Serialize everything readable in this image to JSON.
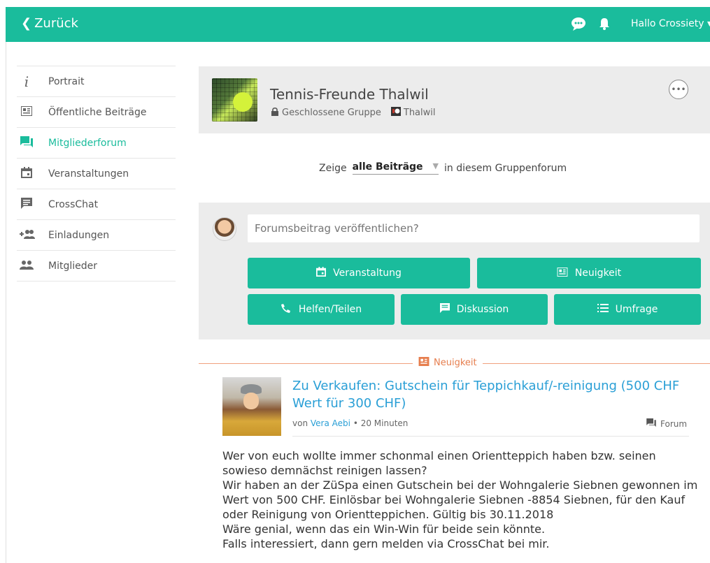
{
  "topbar": {
    "back_label": "Zurück",
    "greeting": "Hallo Crossiety",
    "icons": [
      "chat-bubble-icon",
      "bell-icon"
    ],
    "accent": "#1abc9c"
  },
  "sidebar": {
    "items": [
      {
        "label": "Portrait",
        "icon": "info-icon",
        "active": false
      },
      {
        "label": "Öffentliche Beiträge",
        "icon": "newspaper-icon",
        "active": false
      },
      {
        "label": "Mitgliederforum",
        "icon": "forum-icon",
        "active": true
      },
      {
        "label": "Veranstaltungen",
        "icon": "calendar-icon",
        "active": false
      },
      {
        "label": "CrossChat",
        "icon": "chat-icon",
        "active": false
      },
      {
        "label": "Einladungen",
        "icon": "add-people-icon",
        "active": false
      },
      {
        "label": "Mitglieder",
        "icon": "people-icon",
        "active": false
      }
    ]
  },
  "group": {
    "name": "Tennis-Freunde Thalwil",
    "privacy": "Geschlossene Gruppe",
    "location": "Thalwil"
  },
  "filter": {
    "prefix": "Zeige",
    "selected": "alle Beiträge",
    "suffix": "in diesem Gruppenforum"
  },
  "composer": {
    "placeholder": "Forumsbeitrag veröffentlichen?",
    "buttons": {
      "event": "Veranstaltung",
      "news": "Neuigkeit",
      "help": "Helfen/Teilen",
      "discussion": "Diskussion",
      "poll": "Umfrage"
    }
  },
  "post": {
    "type_label": "Neuigkeit",
    "title": "Zu Verkaufen: Gutschein für Teppichkauf/-reinigung (500 CHF Wert für 300 CHF)",
    "by": "von",
    "author": "Vera Aebi",
    "time": "• 20 Minuten",
    "forum_label": "Forum",
    "body": [
      "Wer von euch wollte immer schonmal einen Orientteppich haben bzw. seinen sowieso demnächst reinigen lassen?",
      "Wir haben an der ZüSpa einen Gutschein bei der Wohngalerie Siebnen gewonnen im Wert von 500 CHF. Einlösbar bei Wohngalerie Siebnen -8854 Siebnen, für den Kauf oder Reinigung von Orientteppichen. Gültig bis 30.11.2018",
      "Wäre genial, wenn das ein Win-Win für beide sein könnte.",
      "Falls interessiert, dann gern melden via CrossChat bei mir."
    ]
  }
}
